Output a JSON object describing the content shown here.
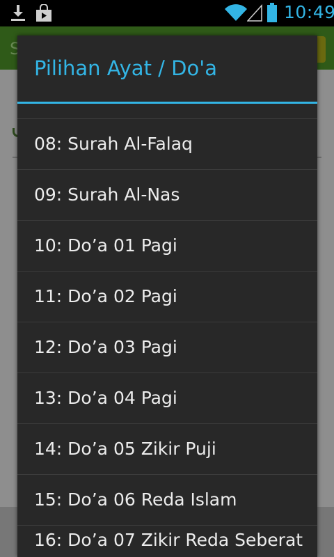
{
  "status_bar": {
    "time": "10:49",
    "icons": [
      "download-icon",
      "shopping-bag-icon",
      "wifi-icon",
      "signal-icon",
      "battery-icon"
    ],
    "accent_color": "#33b5e5"
  },
  "background_app": {
    "header_letter": "S",
    "header_color": "#4caf1a"
  },
  "dialog": {
    "title": "Pilihan Ayat / Do'a",
    "title_color": "#33b5e5",
    "items": [
      {
        "label": ""
      },
      {
        "label": "08: Surah Al-Falaq"
      },
      {
        "label": "09: Surah Al-Nas"
      },
      {
        "label": "10: Do’a 01 Pagi"
      },
      {
        "label": "11: Do’a 02 Pagi"
      },
      {
        "label": "12: Do’a 03 Pagi"
      },
      {
        "label": "13: Do’a 04 Pagi"
      },
      {
        "label": "14: Do’a 05 Zikir Puji"
      },
      {
        "label": "15: Do’a 06 Reda Islam"
      },
      {
        "label": "16: Do’a 07 Zikir Reda Seberat"
      }
    ]
  }
}
